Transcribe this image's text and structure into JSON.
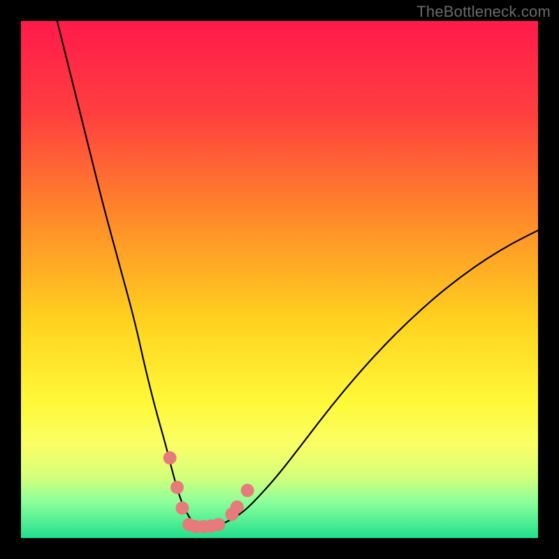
{
  "watermark": "TheBottleneck.com",
  "chart_data": {
    "type": "line",
    "title": "",
    "xlabel": "",
    "ylabel": "",
    "xlim": [
      0,
      100
    ],
    "ylim": [
      0,
      100
    ],
    "grid": false,
    "legend": false,
    "background_gradient": {
      "stops": [
        {
          "pct": 0,
          "color": "#ff1a4b"
        },
        {
          "pct": 18,
          "color": "#ff3f3f"
        },
        {
          "pct": 38,
          "color": "#ff8a2a"
        },
        {
          "pct": 58,
          "color": "#ffd21f"
        },
        {
          "pct": 74,
          "color": "#fff93a"
        },
        {
          "pct": 82,
          "color": "#faff66"
        },
        {
          "pct": 88,
          "color": "#d6ff7a"
        },
        {
          "pct": 93,
          "color": "#8dff9a"
        },
        {
          "pct": 100,
          "color": "#21e08e"
        }
      ]
    },
    "series": [
      {
        "name": "bottleneck-curve",
        "color": "#000000",
        "x": [
          7,
          10,
          13,
          16,
          19,
          22,
          24,
          26,
          28,
          29.5,
          31,
          32.5,
          34,
          36,
          38,
          40,
          43,
          46,
          50,
          55,
          60,
          65,
          70,
          75,
          80,
          85,
          90,
          95,
          100
        ],
        "y": [
          100,
          88,
          76,
          64,
          53,
          42,
          33,
          25,
          18,
          12,
          7,
          4,
          2.2,
          2.2,
          2.4,
          3.2,
          5,
          8,
          12.5,
          19,
          25.5,
          31.5,
          37,
          42,
          46.5,
          50.5,
          54,
          57,
          59.5
        ]
      }
    ],
    "markers": {
      "name": "data-points",
      "color": "#e77b7b",
      "points": [
        {
          "x": 28.8,
          "y": 15.5
        },
        {
          "x": 30.2,
          "y": 9.8
        },
        {
          "x": 31.2,
          "y": 5.8
        },
        {
          "x": 32.5,
          "y": 2.6
        },
        {
          "x": 33.8,
          "y": 2.2
        },
        {
          "x": 35.3,
          "y": 2.2
        },
        {
          "x": 36.8,
          "y": 2.3
        },
        {
          "x": 38.2,
          "y": 2.6
        },
        {
          "x": 40.8,
          "y": 4.6
        },
        {
          "x": 41.8,
          "y": 6.0
        },
        {
          "x": 43.8,
          "y": 9.2
        }
      ]
    }
  }
}
